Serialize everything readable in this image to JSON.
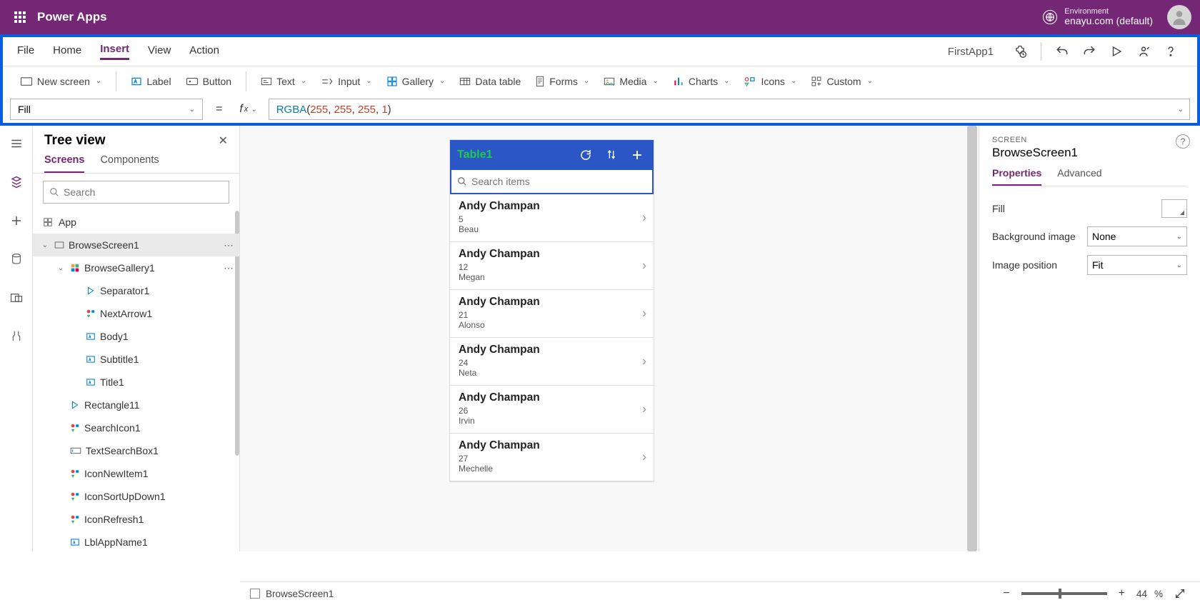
{
  "header": {
    "brand": "Power Apps",
    "env_label": "Environment",
    "env_value": "enayu.com (default)"
  },
  "menubar": {
    "items": [
      "File",
      "Home",
      "Insert",
      "View",
      "Action"
    ],
    "active": "Insert",
    "app_name": "FirstApp1"
  },
  "ribbon": {
    "newScreen": "New screen",
    "label": "Label",
    "button": "Button",
    "text": "Text",
    "input": "Input",
    "gallery": "Gallery",
    "dataTable": "Data table",
    "forms": "Forms",
    "media": "Media",
    "charts": "Charts",
    "icons": "Icons",
    "custom": "Custom"
  },
  "formula": {
    "prop": "Fill",
    "fn": "RGBA",
    "args": [
      "255",
      "255",
      "255",
      "1"
    ]
  },
  "tree": {
    "title": "Tree view",
    "tabs": [
      "Screens",
      "Components"
    ],
    "active_tab": "Screens",
    "search_ph": "Search",
    "app": "App",
    "items": [
      {
        "indent": 0,
        "label": "BrowseScreen1",
        "expanded": true,
        "sel": true,
        "more": true,
        "icon": "screen"
      },
      {
        "indent": 1,
        "label": "BrowseGallery1",
        "expanded": true,
        "more": true,
        "icon": "gallery"
      },
      {
        "indent": 2,
        "label": "Separator1",
        "icon": "sep"
      },
      {
        "indent": 2,
        "label": "NextArrow1",
        "icon": "iconctl"
      },
      {
        "indent": 2,
        "label": "Body1",
        "icon": "label"
      },
      {
        "indent": 2,
        "label": "Subtitle1",
        "icon": "label"
      },
      {
        "indent": 2,
        "label": "Title1",
        "icon": "label"
      },
      {
        "indent": 1,
        "label": "Rectangle11",
        "icon": "sep"
      },
      {
        "indent": 1,
        "label": "SearchIcon1",
        "icon": "iconctl"
      },
      {
        "indent": 1,
        "label": "TextSearchBox1",
        "icon": "textbox"
      },
      {
        "indent": 1,
        "label": "IconNewItem1",
        "icon": "iconctl"
      },
      {
        "indent": 1,
        "label": "IconSortUpDown1",
        "icon": "iconctl"
      },
      {
        "indent": 1,
        "label": "IconRefresh1",
        "icon": "iconctl"
      },
      {
        "indent": 1,
        "label": "LblAppName1",
        "icon": "label"
      }
    ]
  },
  "canvas": {
    "phone_title": "Table1",
    "search_ph": "Search items",
    "rows": [
      {
        "t": "Andy Champan",
        "n": "5",
        "s": "Beau"
      },
      {
        "t": "Andy Champan",
        "n": "12",
        "s": "Megan"
      },
      {
        "t": "Andy Champan",
        "n": "21",
        "s": "Alonso"
      },
      {
        "t": "Andy Champan",
        "n": "24",
        "s": "Neta"
      },
      {
        "t": "Andy Champan",
        "n": "26",
        "s": "Irvin"
      },
      {
        "t": "Andy Champan",
        "n": "27",
        "s": "Mechelle"
      }
    ]
  },
  "props": {
    "screen_lbl": "SCREEN",
    "screen_name": "BrowseScreen1",
    "tabs": [
      "Properties",
      "Advanced"
    ],
    "active_tab": "Properties",
    "fill_lbl": "Fill",
    "bg_lbl": "Background image",
    "bg_val": "None",
    "imgpos_lbl": "Image position",
    "imgpos_val": "Fit"
  },
  "footer": {
    "screen": "BrowseScreen1",
    "zoom": "44",
    "zoom_suffix": " %"
  }
}
